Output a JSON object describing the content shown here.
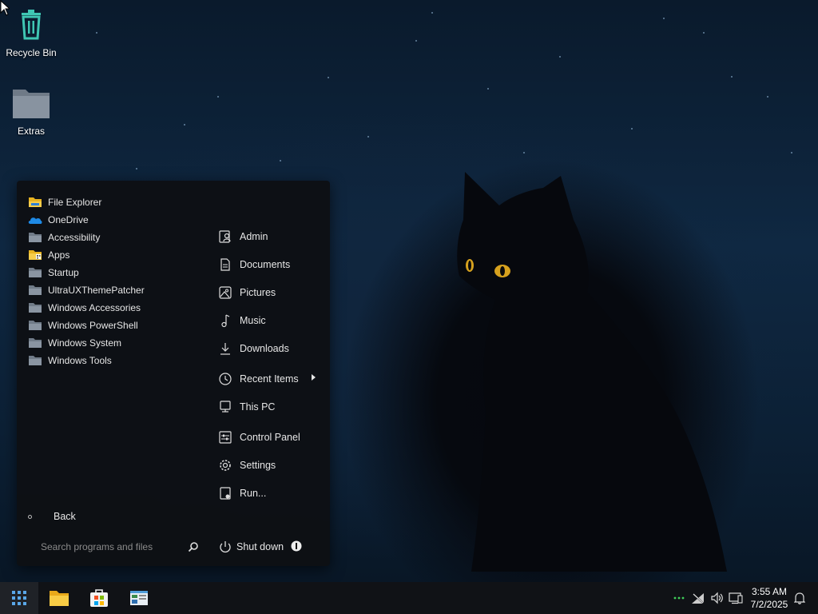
{
  "desktop": {
    "icons": [
      {
        "label": "Recycle Bin",
        "icon": "recycle-bin-icon"
      },
      {
        "label": "Extras",
        "icon": "folder-icon"
      }
    ]
  },
  "start_menu": {
    "programs": [
      {
        "label": "File Explorer",
        "icon": "file-explorer-icon"
      },
      {
        "label": "OneDrive",
        "icon": "onedrive-icon"
      },
      {
        "label": "Accessibility",
        "icon": "folder-icon"
      },
      {
        "label": "Apps",
        "icon": "apps-folder-icon"
      },
      {
        "label": "Startup",
        "icon": "folder-icon"
      },
      {
        "label": "UltraUXThemePatcher",
        "icon": "folder-icon"
      },
      {
        "label": "Windows Accessories",
        "icon": "folder-icon"
      },
      {
        "label": "Windows PowerShell",
        "icon": "folder-icon"
      },
      {
        "label": "Windows System",
        "icon": "folder-icon"
      },
      {
        "label": "Windows Tools",
        "icon": "folder-icon"
      }
    ],
    "places": [
      {
        "label": "Admin",
        "icon": "user-icon"
      },
      {
        "label": "Documents",
        "icon": "document-icon"
      },
      {
        "label": "Pictures",
        "icon": "picture-icon"
      },
      {
        "label": "Music",
        "icon": "music-icon"
      },
      {
        "label": "Downloads",
        "icon": "download-icon"
      },
      {
        "label": "Recent Items",
        "icon": "clock-icon",
        "submenu": true
      },
      {
        "label": "This PC",
        "icon": "computer-icon"
      },
      {
        "label": "Control Panel",
        "icon": "control-panel-icon"
      },
      {
        "label": "Settings",
        "icon": "gear-icon"
      },
      {
        "label": "Run...",
        "icon": "run-icon"
      }
    ],
    "back_label": "Back",
    "search_placeholder": "Search programs and files",
    "shutdown_label": "Shut down"
  },
  "taskbar": {
    "pinned": [
      "start-icon",
      "file-explorer-icon",
      "store-icon",
      "control-panel-icon"
    ],
    "clock_time": "3:55 AM",
    "clock_date": "7/2/2025"
  }
}
